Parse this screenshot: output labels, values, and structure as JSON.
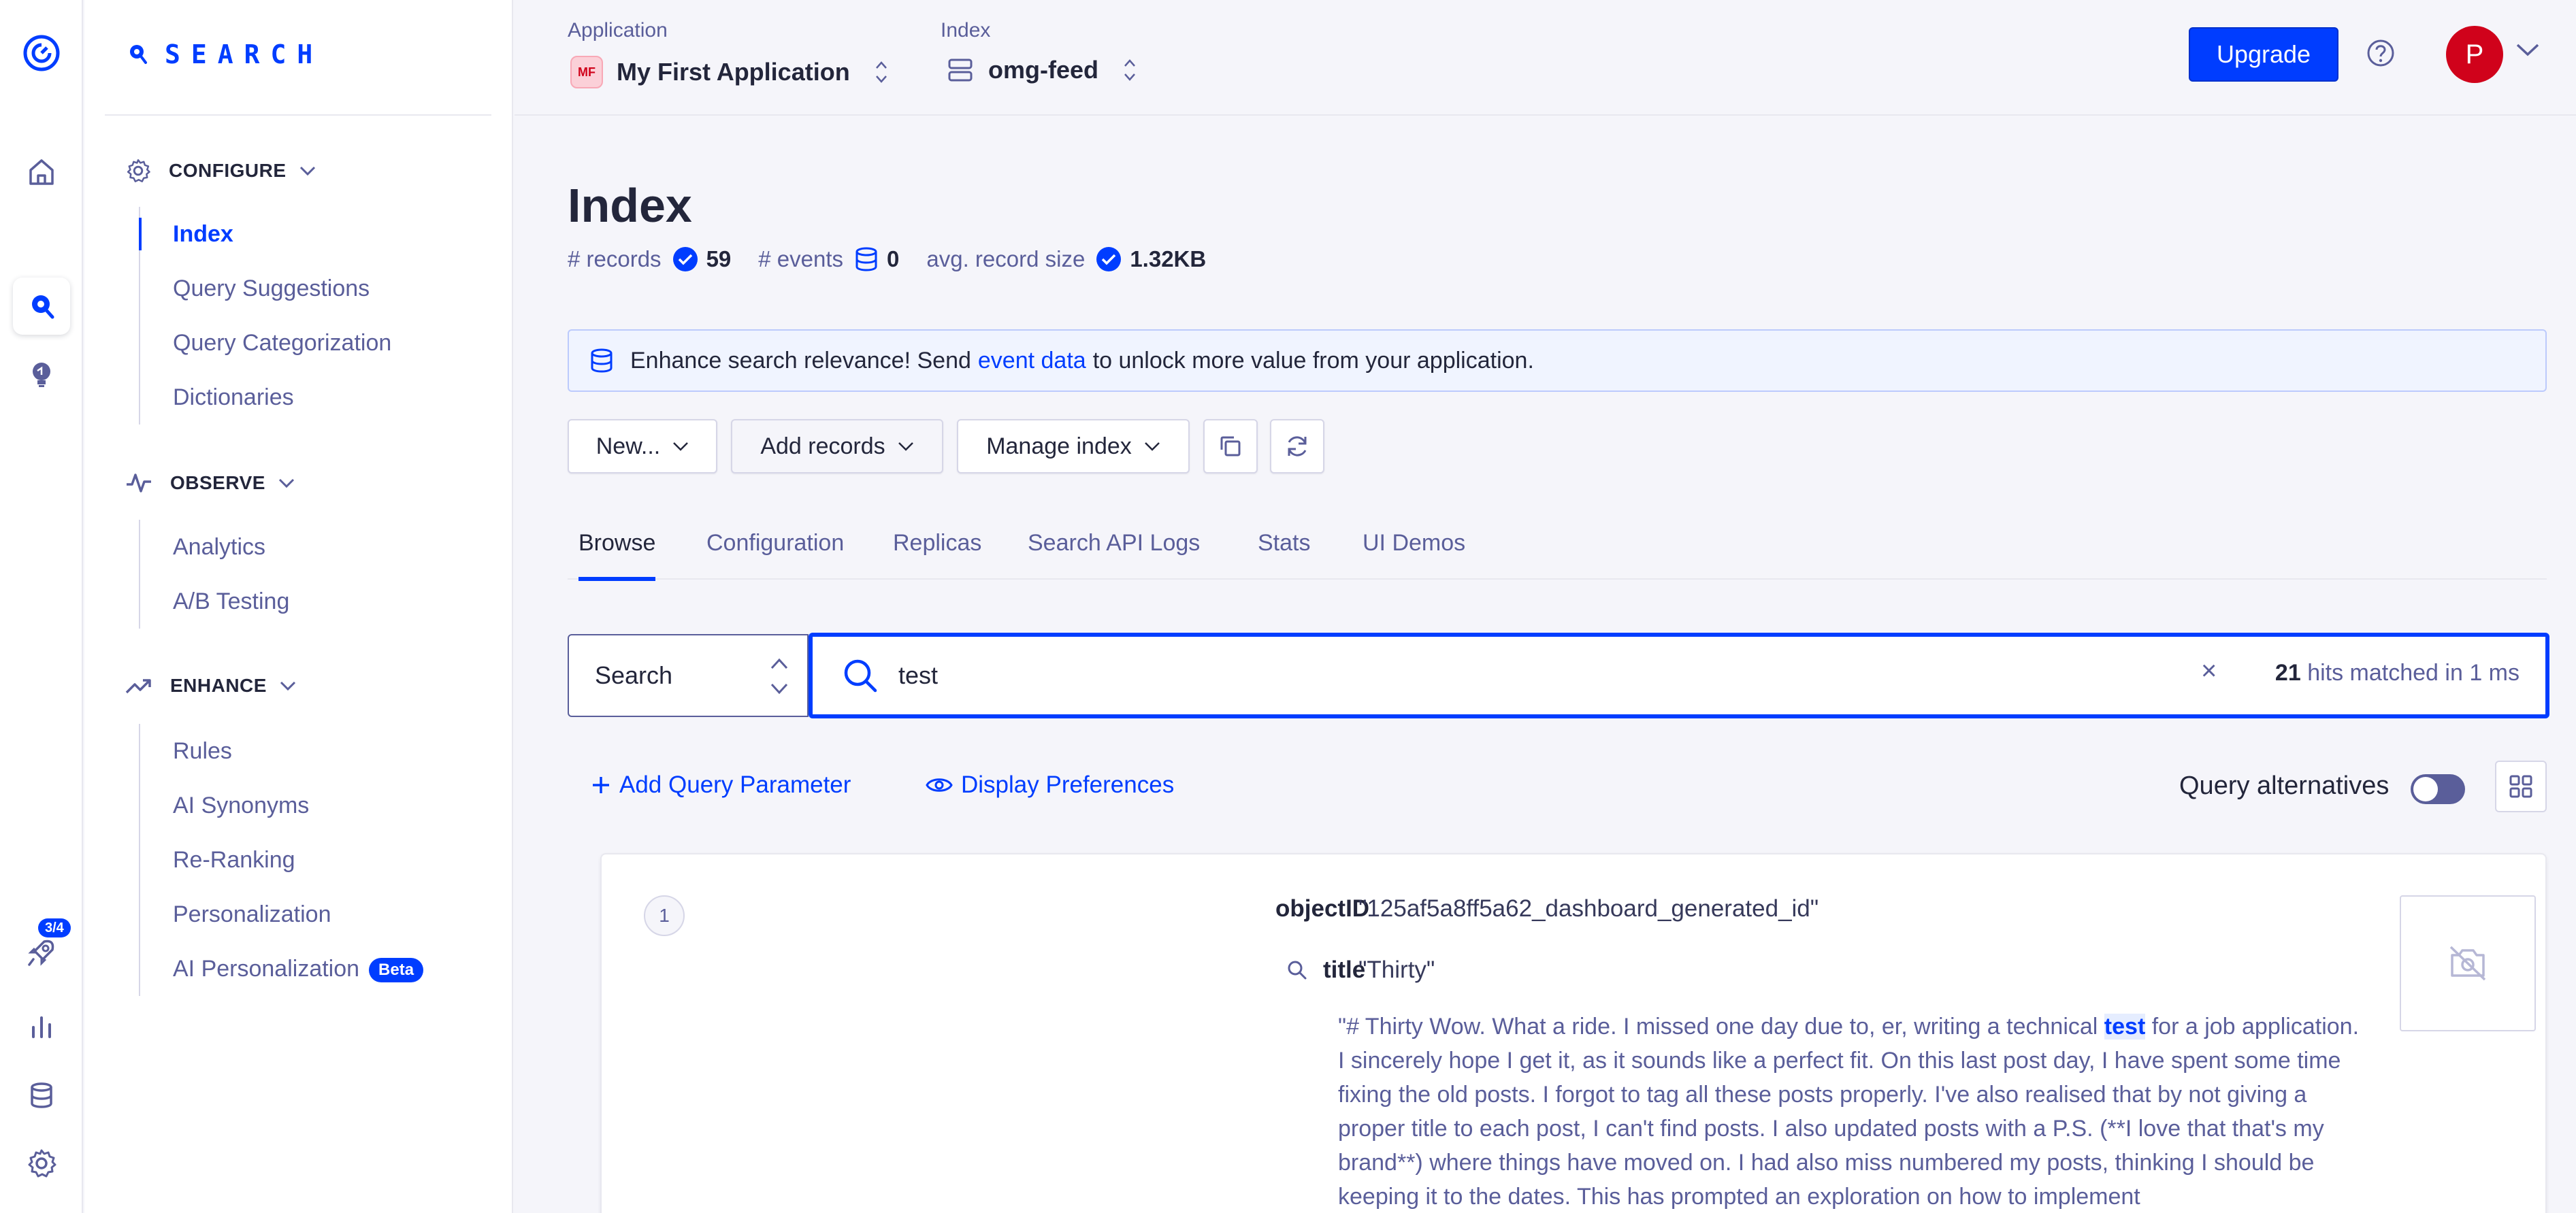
{
  "rail": {
    "badge": "3/4",
    "icons": [
      "algolia-logo-icon",
      "home-icon",
      "search-product-icon",
      "recommend-bulb-icon",
      "onboarding-rocket-icon",
      "analytics-bar-icon",
      "data-sources-icon",
      "settings-gear-icon"
    ]
  },
  "sidebar": {
    "logo_text": "SEARCH",
    "sections": {
      "configure": {
        "label": "CONFIGURE",
        "items": [
          "Index",
          "Query Suggestions",
          "Query Categorization",
          "Dictionaries"
        ]
      },
      "observe": {
        "label": "OBSERVE",
        "items": [
          "Analytics",
          "A/B Testing"
        ]
      },
      "enhance": {
        "label": "ENHANCE",
        "items": [
          "Rules",
          "AI Synonyms",
          "Re-Ranking",
          "Personalization",
          "AI Personalization"
        ],
        "badge": "Beta"
      }
    }
  },
  "topbar": {
    "application_label": "Application",
    "application_badge": "MF",
    "application_value": "My First Application",
    "index_label": "Index",
    "index_value": "omg-feed",
    "upgrade_label": "Upgrade",
    "avatar_initial": "P"
  },
  "page": {
    "title": "Index",
    "stats": {
      "records_label": "# records",
      "records_value": "59",
      "events_label": "# events",
      "events_value": "0",
      "size_label": "avg. record size",
      "size_value": "1.32KB"
    },
    "banner": {
      "before": "Enhance search relevance! Send",
      "link": "event data",
      "after": "to unlock more value from your application."
    },
    "toolbar": {
      "new_label": "New...",
      "add_records_label": "Add records",
      "manage_index_label": "Manage index"
    },
    "tabs": [
      "Browse",
      "Configuration",
      "Replicas",
      "Search API Logs",
      "Stats",
      "UI Demos"
    ],
    "active_tab": "Browse"
  },
  "search": {
    "type_value": "Search",
    "query": "test",
    "clear": "×",
    "hits_count": "21",
    "hits_text": "hits matched in 1 ms",
    "add_param_label": "Add Query Parameter",
    "display_prefs_label": "Display Preferences",
    "query_alternatives_label": "Query alternatives",
    "query_alternatives_on": false
  },
  "hit": {
    "position": "1",
    "object_id_key": "objectID",
    "object_id_value": "\"125af5a8ff5a62_dashboard_generated_id\"",
    "title_key": "title",
    "title_value": "\"Thirty\"",
    "content_before": "\"# Thirty Wow. What a ride. I missed one day due to, er, writing a technical",
    "content_highlight": "test",
    "content_after": "for a job application. I sincerely hope I get it, as it sounds like a perfect fit. On this last post day, I have spent some time fixing the old posts. I forgot to tag all these posts properly. I've also realised that by not giving a proper title to each post, I can't find posts. I also updated posts with a P.S. (**I love that that's my brand**) where things have moved on. I had also miss numbered my posts, thinking I should be keeping it to the dates. This has prompted an exploration on how to implement"
  },
  "colors": {
    "accent": "#003dff",
    "text": "#23263b",
    "muted": "#5a5e9a",
    "avatar": "#d0021b"
  }
}
